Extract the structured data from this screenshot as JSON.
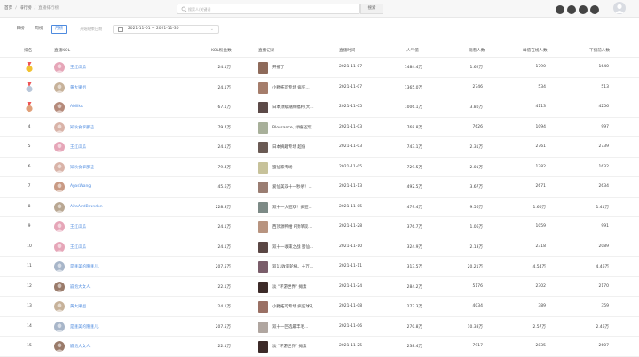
{
  "breadcrumb": {
    "home": "首页",
    "section": "排行榜",
    "current": "直播排行榜"
  },
  "search": {
    "placeholder": "搜索人/关键词",
    "button": "搜索"
  },
  "header_icons": [
    "notification-icon",
    "message-icon",
    "settings-icon",
    "help-icon"
  ],
  "filters": {
    "tabs": [
      {
        "label": "日榜",
        "active": false
      },
      {
        "label": "周榜",
        "active": false
      },
      {
        "label": "月榜",
        "active": true
      }
    ],
    "date_label": "开始结束日期",
    "date_range": "2021-11-01 ~ 2021-11-30"
  },
  "columns": [
    "排名",
    "直播KOL",
    "KOL粉丝数",
    "直播记录",
    "直播时间",
    "人气值",
    "观看人数",
    "峰值在线人数",
    "下播前人数"
  ],
  "colors": {
    "accent": "#4e8bdf",
    "header_bg": "#f7f7f7"
  },
  "rows": [
    {
      "rank": "1",
      "medal": "gold",
      "kol": "王红瓜瓜",
      "fans": "24.1万",
      "record": "开播了",
      "time": "2021-11-07",
      "popularity": "1484.4万",
      "viewers": "1.62万",
      "peak": "1790",
      "end": "1640",
      "av": "#e6a6b8",
      "th": "#8e6a5a"
    },
    {
      "rank": "2",
      "medal": "silver",
      "kol": "黄大果姐",
      "fans": "24.1万",
      "record": "小野拓可专场 疯狂...",
      "time": "2021-11-07",
      "popularity": "1365.0万",
      "viewers": "2746",
      "peak": "534",
      "end": "513",
      "av": "#c7b29a",
      "th": "#a57d6b"
    },
    {
      "rank": "3",
      "medal": "bronze",
      "kol": "Akiiiku",
      "fans": "67.1万",
      "record": "日本顶级潮牌福利(大...",
      "time": "2021-11-05",
      "popularity": "1006.1万",
      "viewers": "3.80万",
      "peak": "4113",
      "end": "4256",
      "av": "#b58a7a",
      "th": "#5c4a48"
    },
    {
      "rank": "4",
      "medal": "",
      "kol": "知秋食翠那些",
      "fans": "79.4万",
      "record": "Blossance, 绿植轻案...",
      "time": "2021-11-03",
      "popularity": "768.8万",
      "viewers": "7626",
      "peak": "1094",
      "end": "997",
      "av": "#d9b3a8",
      "th": "#a8b09a"
    },
    {
      "rank": "5",
      "medal": "",
      "kol": "王红瓜瓜",
      "fans": "24.1万",
      "record": "日本摘趣专场 超值",
      "time": "2021-11-03",
      "popularity": "743.1万",
      "viewers": "2.31万",
      "peak": "2761",
      "end": "2739",
      "av": "#e6a6b8",
      "th": "#6a5a54"
    },
    {
      "rank": "6",
      "medal": "",
      "kol": "知秋食翠那些",
      "fans": "79.4万",
      "record": "蜜仙家专场",
      "time": "2021-11-05",
      "popularity": "729.5万",
      "viewers": "2.01万",
      "peak": "1782",
      "end": "1632",
      "av": "#d9b3a8",
      "th": "#c7c29a"
    },
    {
      "rank": "7",
      "medal": "",
      "kol": "AyasWang",
      "fans": "45.6万",
      "record": "爱仙美双十一秒杀！...",
      "time": "2021-11-13",
      "popularity": "492.5万",
      "viewers": "3.67万",
      "peak": "2671",
      "end": "2634",
      "av": "#c99a84",
      "th": "#9a7d72"
    },
    {
      "rank": "8",
      "medal": "",
      "kol": "AitaAndBrandon",
      "fans": "228.3万",
      "record": "双十一大狂欢！疯狂...",
      "time": "2021-11-05",
      "popularity": "479.4万",
      "viewers": "9.56万",
      "peak": "1.60万",
      "end": "1.41万",
      "av": "#b9a792",
      "th": "#7d8a86"
    },
    {
      "rank": "9",
      "medal": "",
      "kol": "王红瓜瓜",
      "fans": "24.1万",
      "record": "西顶源鸭柑 P顶单双...",
      "time": "2021-11-28",
      "popularity": "376.7万",
      "viewers": "1.06万",
      "peak": "1059",
      "end": "991",
      "av": "#e6a6b8",
      "th": "#b89480"
    },
    {
      "rank": "10",
      "medal": "",
      "kol": "王红瓜瓜",
      "fans": "24.1万",
      "record": "双十一收束之战 蜜仙...",
      "time": "2021-11-10",
      "popularity": "324.9万",
      "viewers": "2.13万",
      "peak": "2318",
      "end": "2089",
      "av": "#e6a6b8",
      "th": "#5a4644"
    },
    {
      "rank": "11",
      "medal": "",
      "kol": "是隆美的隆隆儿",
      "fans": "207.5万",
      "record": "双11收束轮播。十万...",
      "time": "2021-11-11",
      "popularity": "313.5万",
      "viewers": "20.21万",
      "peak": "4.54万",
      "end": "4.46万",
      "av": "#a8b6c9",
      "th": "#7a5d6a"
    },
    {
      "rank": "12",
      "medal": "",
      "kol": "崩炮大女人",
      "fans": "22.1万",
      "record": "淡 \"环游世界\" 摊素",
      "time": "2021-11-24",
      "popularity": "284.2万",
      "viewers": "5176",
      "peak": "2302",
      "end": "2170",
      "av": "#9a7b6a",
      "th": "#3c2a28"
    },
    {
      "rank": "13",
      "medal": "",
      "kol": "黄大果姐",
      "fans": "24.1万",
      "record": "小野拓可专场 疯狂球礼",
      "time": "2021-11-08",
      "popularity": "273.3万",
      "viewers": "4034",
      "peak": "389",
      "end": "359",
      "av": "#c7b29a",
      "th": "#9a7064"
    },
    {
      "rank": "14",
      "medal": "",
      "kol": "是隆美的隆隆儿",
      "fans": "207.5万",
      "record": "双十一回选最丰毛...",
      "time": "2021-11-06",
      "popularity": "270.8万",
      "viewers": "10.38万",
      "peak": "2.57万",
      "end": "2.46万",
      "av": "#a8b6c9",
      "th": "#b0a6a0"
    },
    {
      "rank": "15",
      "medal": "",
      "kol": "崩炮大女人",
      "fans": "22.1万",
      "record": "淡 \"环游世界\" 摊素",
      "time": "2021-11-25",
      "popularity": "238.4万",
      "viewers": "7917",
      "peak": "2835",
      "end": "2607",
      "av": "#9a7b6a",
      "th": "#3c2a28"
    }
  ]
}
